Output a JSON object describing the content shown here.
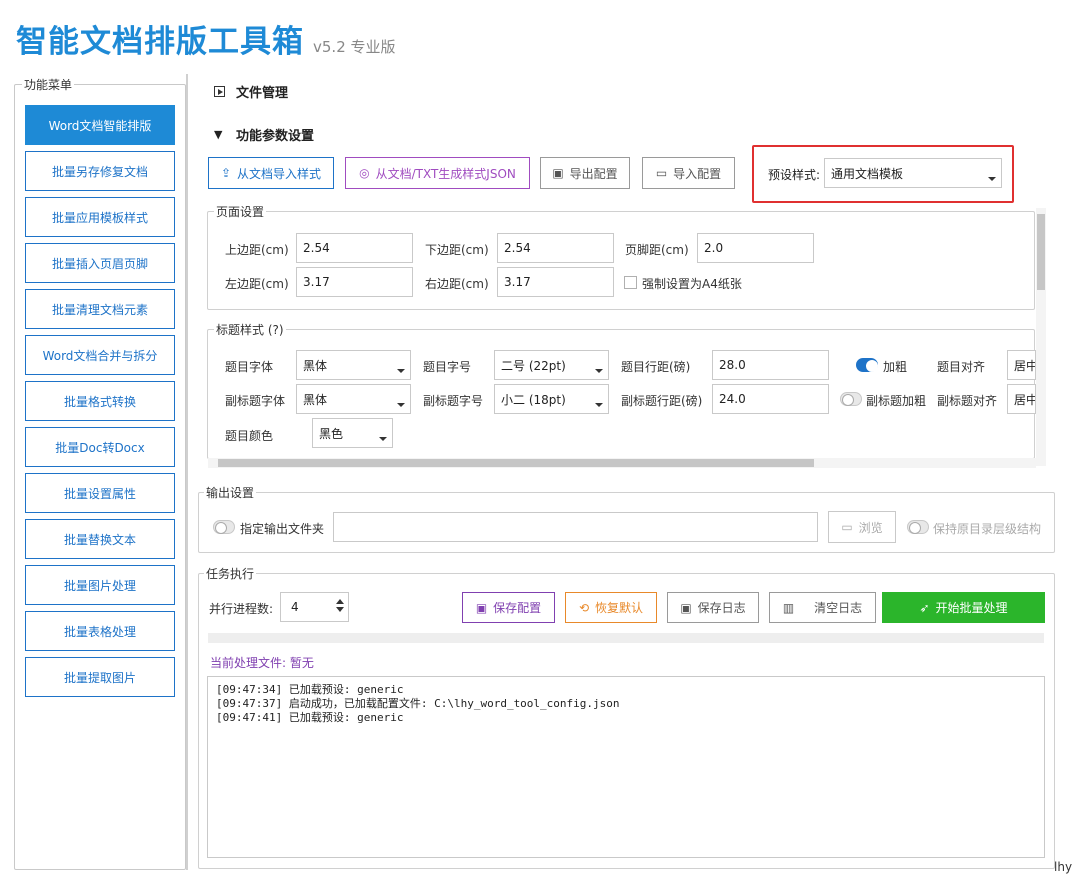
{
  "header": {
    "title": "智能文档排版工具箱",
    "version": "v5.2 专业版"
  },
  "sidebar": {
    "legend": "功能菜单",
    "items": [
      {
        "label": "Word文档智能排版",
        "active": true
      },
      {
        "label": "批量另存修复文档"
      },
      {
        "label": "批量应用模板样式"
      },
      {
        "label": "批量插入页眉页脚"
      },
      {
        "label": "批量清理文档元素"
      },
      {
        "label": "Word文档合并与拆分"
      },
      {
        "label": "批量格式转换"
      },
      {
        "label": "批量Doc转Docx"
      },
      {
        "label": "批量设置属性"
      },
      {
        "label": "批量替换文本"
      },
      {
        "label": "批量图片处理"
      },
      {
        "label": "批量表格处理"
      },
      {
        "label": "批量提取图片"
      }
    ]
  },
  "sections": {
    "file_mgmt": "文件管理",
    "params": "功能参数设置"
  },
  "toolbar": {
    "import_style": "从文档导入样式",
    "gen_json": "从文档/TXT生成样式JSON",
    "export_cfg": "导出配置",
    "import_cfg": "导入配置",
    "preset_label": "预设样式:",
    "preset_value": "通用文档模板"
  },
  "page_setup": {
    "legend": "页面设置",
    "top_label": "上边距(cm)",
    "top_value": "2.54",
    "bottom_label": "下边距(cm)",
    "bottom_value": "2.54",
    "footer_label": "页脚距(cm)",
    "footer_value": "2.0",
    "left_label": "左边距(cm)",
    "left_value": "3.17",
    "right_label": "右边距(cm)",
    "right_value": "3.17",
    "a4_label": "强制设置为A4纸张"
  },
  "title_style": {
    "legend": "标题样式 (?)",
    "font_label": "题目字体",
    "font_value": "黑体",
    "size_label": "题目字号",
    "size_value": "二号 (22pt)",
    "spacing_label": "题目行距(磅)",
    "spacing_value": "28.0",
    "bold_label": "加粗",
    "align_label": "题目对齐",
    "align_value": "居中",
    "sub_font_label": "副标题字体",
    "sub_font_value": "黑体",
    "sub_size_label": "副标题字号",
    "sub_size_value": "小二 (18pt)",
    "sub_spacing_label": "副标题行距(磅)",
    "sub_spacing_value": "24.0",
    "sub_bold_label": "副标题加粗",
    "sub_align_label": "副标题对齐",
    "sub_align_value": "居中",
    "color_label": "题目颜色",
    "color_value": "黑色"
  },
  "output": {
    "legend": "输出设置",
    "folder_label": "指定输出文件夹",
    "folder_value": "",
    "browse": "浏览",
    "keep_structure": "保持原目录层级结构"
  },
  "task": {
    "legend": "任务执行",
    "parallel_label": "并行进程数:",
    "parallel_value": "4",
    "save_cfg": "保存配置",
    "restore": "恢复默认",
    "save_log": "保存日志",
    "clear_log": "清空日志",
    "start": "开始批量处理",
    "current_file": "当前处理文件: 暂无",
    "log_lines": [
      "[09:47:34] 已加载预设: generic",
      "[09:47:37] 启动成功，已加载配置文件: C:\\lhy_word_tool_config.json",
      "[09:47:41] 已加载预设: generic"
    ]
  },
  "corner_text": "lhy",
  "colors": {
    "accent": "#1e8ad6",
    "highlight": "#e03030",
    "start": "#2bb52b"
  }
}
